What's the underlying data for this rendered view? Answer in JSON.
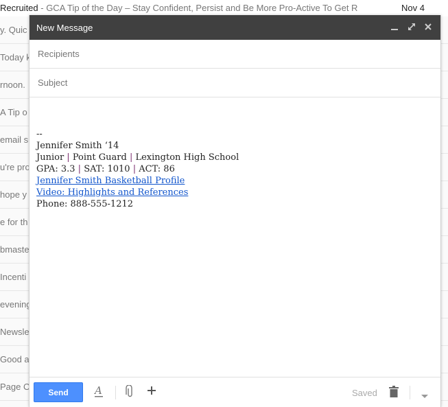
{
  "inbox": {
    "first_row": {
      "sender": "Recruited",
      "subject": " - GCA Tip of the Day – Stay Confident, Persist and Be More Pro-Active To Get R",
      "date": "Nov 4"
    },
    "snippets": [
      "y. Quic",
      "Today k",
      "rnoon. ",
      "A Tip o",
      "email su",
      "u're prol",
      " hope y",
      "e for th",
      "bmaste",
      " Incenti",
      "evening.",
      " Newsle",
      "Good aft",
      "Page O"
    ]
  },
  "compose": {
    "title": "New Message",
    "header_buttons": {
      "minimize": "minimize-icon",
      "expand": "expand-icon",
      "close": "close-icon"
    },
    "recipients_placeholder": "Recipients",
    "subject_placeholder": "Subject",
    "signature": {
      "dash": "--",
      "name": "Jennifer Smith ‘14",
      "line2": [
        "Junior",
        "Point Guard",
        "Lexington High School"
      ],
      "line3": [
        "GPA: 3.3",
        "SAT: 1010",
        "ACT: 86"
      ],
      "link1": "Jennifer Smith Basketball Profile ",
      "link2": "Video: Highlights and References ",
      "phone": "Phone: 888-555-1212"
    },
    "footer": {
      "send_label": "Send",
      "saved_label": "Saved",
      "icons": [
        "formatting-icon",
        "attach-icon",
        "more-options-icon",
        "trash-icon",
        "dropdown-icon"
      ]
    }
  },
  "colors": {
    "header_bg": "#404040",
    "send_bg": "#4d90fe",
    "link": "#1155cc",
    "separator": "#7a2b6e"
  }
}
